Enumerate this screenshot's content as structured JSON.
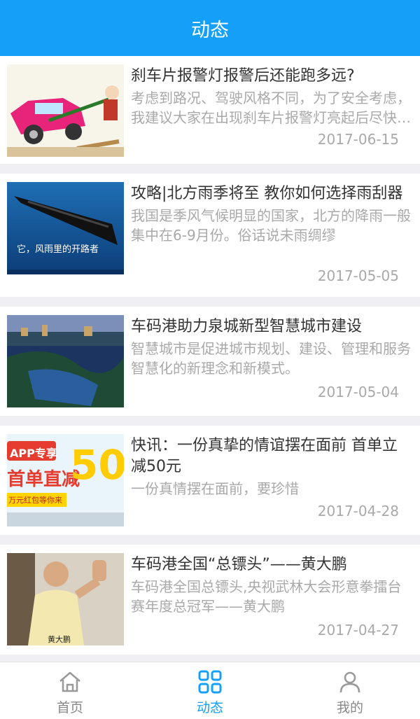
{
  "header": {
    "title": "动态"
  },
  "articles": [
    {
      "title": "刹车片报警灯报警后还能跑多远?",
      "summary": "考虑到路况、驾驶风格不同，为了安全考虑，我建议大家在出现刹车片报警灯亮起后尽快更换刹车片",
      "date": "2017-06-15",
      "thumb": "car-cartoon-image"
    },
    {
      "title": "攻略|北方雨季将至 教你如何选择雨刮器",
      "summary": "我国是季风气候明显的国家，北方的降雨一般集中在6-9月份。俗话说未雨绸缪",
      "date": "2017-05-05",
      "thumb": "wiper-blade-image",
      "thumb_text": "它，风雨里的开路者"
    },
    {
      "title": "车码港助力泉城新型智慧城市建设",
      "summary": "智慧城市是促进城市规划、建设、管理和服务智慧化的新理念和新模式。",
      "date": "2017-05-04",
      "thumb": "city-night-image"
    },
    {
      "title": "快讯：一份真挚的情谊摆在面前 首单立减50元",
      "summary": "一份真情摆在面前，要珍惜",
      "date": "2017-04-28",
      "thumb": "promo-banner-image",
      "thumb_text_1": "APP专享",
      "thumb_text_2": "首单直减",
      "thumb_text_3": "50",
      "thumb_text_4": "万元红包等你来"
    },
    {
      "title": "车码港全国“总镖头”——黄大鹏",
      "summary": "车码港全国总镖头,央视武林大会形意拳擂台赛年度总冠军——黄大鹏",
      "date": "2017-04-27",
      "thumb": "martial-artist-image",
      "thumb_text": "黄大鹏"
    }
  ],
  "tabbar": {
    "tabs": [
      {
        "label": "首页",
        "icon": "home-icon",
        "active": false
      },
      {
        "label": "动态",
        "icon": "grid-icon",
        "active": true
      },
      {
        "label": "我的",
        "icon": "user-icon",
        "active": false
      }
    ]
  },
  "colors": {
    "accent": "#14a0f8",
    "muted": "#a9a9a9",
    "background": "#efeff4"
  }
}
